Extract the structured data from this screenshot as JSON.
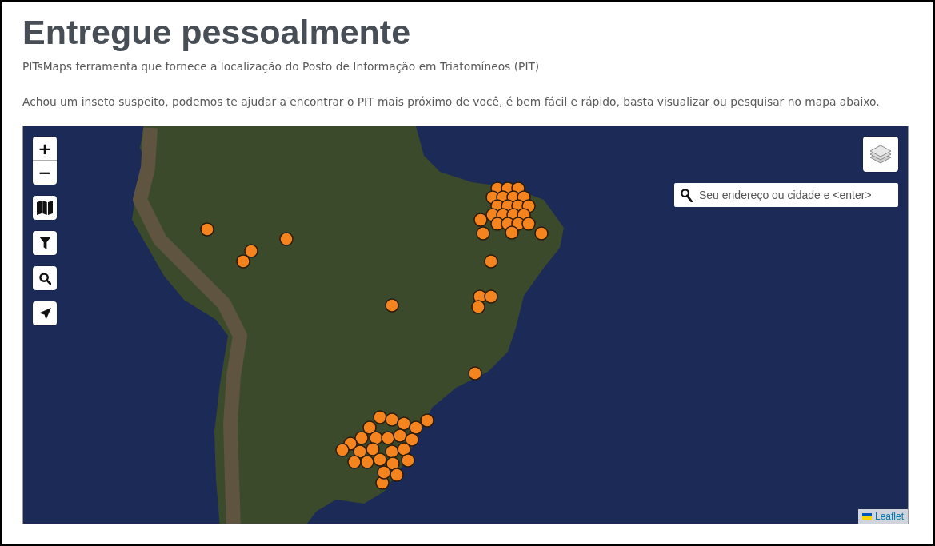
{
  "header": {
    "title": "Entregue pessoalmente",
    "subtitle": "PITsMaps ferramenta que fornece a localização do Posto de Informação em Triatomíneos (PIT)",
    "intro": "Achou um inseto suspeito, podemos te ajudar a encontrar o PIT mais próximo de você, é bem fácil e rápido, basta visualizar ou pesquisar no mapa abaixo."
  },
  "map": {
    "left_controls": [
      {
        "kind": "zoom_in",
        "label": "+"
      },
      {
        "kind": "zoom_out",
        "label": "−"
      },
      {
        "kind": "basemap"
      },
      {
        "kind": "filter"
      },
      {
        "kind": "search"
      },
      {
        "kind": "locate"
      }
    ],
    "right_controls": [
      {
        "kind": "layers"
      }
    ],
    "search_field": {
      "placeholder": "Seu endereço ou cidade e <enter>"
    },
    "attribution": {
      "link": "Leaflet"
    }
  }
}
